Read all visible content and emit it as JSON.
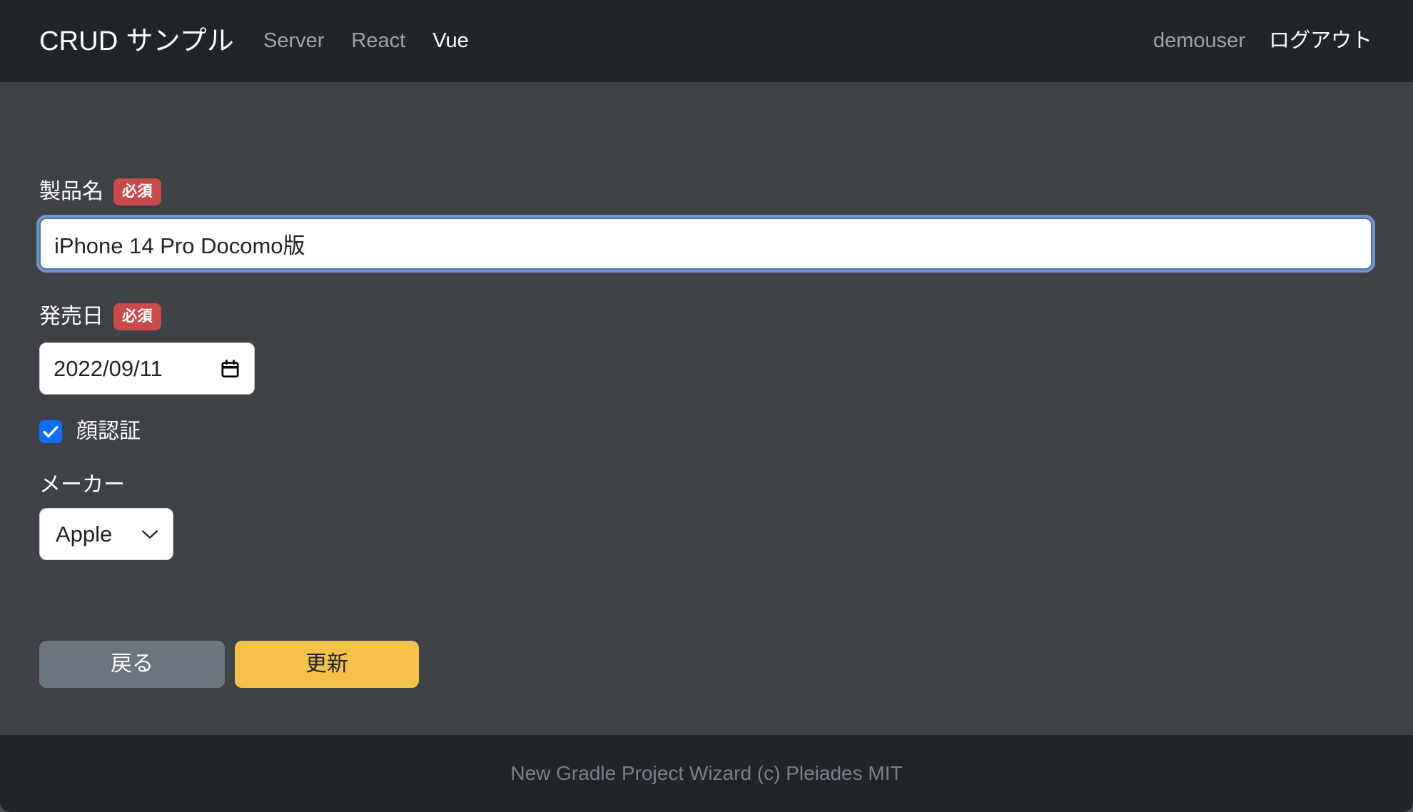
{
  "navbar": {
    "brand": "CRUD サンプル",
    "links": [
      {
        "label": "Server",
        "active": false
      },
      {
        "label": "React",
        "active": false
      },
      {
        "label": "Vue",
        "active": true
      }
    ],
    "user": "demouser",
    "logout": "ログアウト"
  },
  "form": {
    "product_name": {
      "label": "製品名",
      "required_badge": "必須",
      "value": "iPhone 14 Pro Docomo版",
      "placeholder": ""
    },
    "release_date": {
      "label": "発売日",
      "required_badge": "必須",
      "value": "2022/09/11",
      "icon": "calendar-icon"
    },
    "face_auth": {
      "label": "顔認証",
      "checked": true,
      "icon": "check-icon"
    },
    "maker": {
      "label": "メーカー",
      "value": "Apple",
      "icon": "chevron-down-icon"
    }
  },
  "buttons": {
    "back": "戻る",
    "update": "更新"
  },
  "footer": {
    "text": "New Gradle Project Wizard (c) Pleiades MIT"
  },
  "colors": {
    "navbar_bg": "#212529",
    "body_bg": "#3e4145",
    "required_badge": "#c94a4a",
    "checkbox_accent": "#0d6efd",
    "focus_border": "#4a72b8",
    "btn_back_bg": "#6c757d",
    "btn_update_bg": "#f5c249",
    "footer_text": "#7a8089"
  }
}
